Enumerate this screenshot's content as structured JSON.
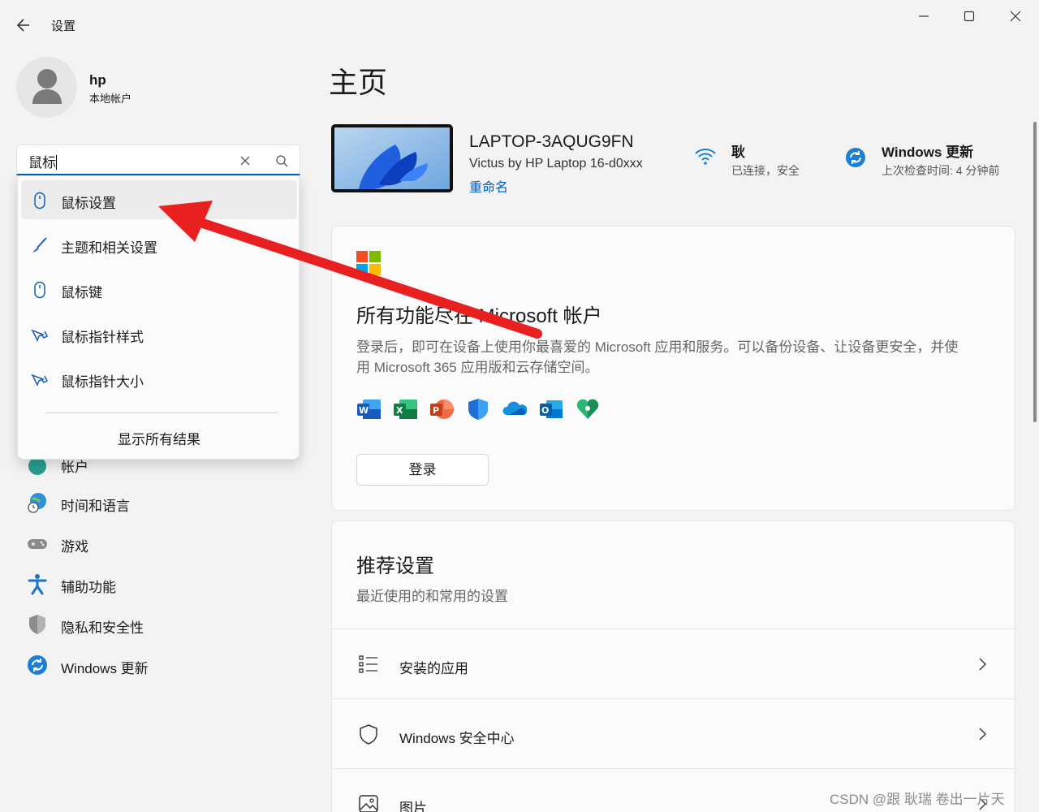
{
  "window": {
    "title": "设置"
  },
  "profile": {
    "name": "hp",
    "account_type": "本地帐户"
  },
  "search": {
    "value": "鼠标",
    "results": [
      {
        "label": "鼠标设置",
        "icon": "mouse-icon"
      },
      {
        "label": "主题和相关设置",
        "icon": "brush-icon"
      },
      {
        "label": "鼠标键",
        "icon": "mouse-icon"
      },
      {
        "label": "鼠标指针样式",
        "icon": "pointer-icon"
      },
      {
        "label": "鼠标指针大小",
        "icon": "pointer-icon"
      }
    ],
    "show_all": "显示所有结果"
  },
  "sidebar": {
    "items": [
      {
        "label": "帐户",
        "icon": "account-icon"
      },
      {
        "label": "时间和语言",
        "icon": "time-language-icon"
      },
      {
        "label": "游戏",
        "icon": "gamepad-icon"
      },
      {
        "label": "辅助功能",
        "icon": "accessibility-icon"
      },
      {
        "label": "隐私和安全性",
        "icon": "shield-icon"
      },
      {
        "label": "Windows 更新",
        "icon": "update-icon"
      }
    ]
  },
  "main": {
    "title": "主页",
    "device": {
      "name": "LAPTOP-3AQUG9FN",
      "model": "Victus by HP Laptop 16-d0xxx",
      "rename": "重命名"
    },
    "network": {
      "name": "耿",
      "status": "已连接，安全"
    },
    "update": {
      "title": "Windows 更新",
      "status": "上次检查时间: 4 分钟前"
    },
    "ms_card": {
      "heading": "所有功能尽在 Microsoft 帐户",
      "desc_line1": "登录后，即可在设备上使用你最喜爱的 Microsoft 应用和服务。可以备份设备、让设备更安全，并使",
      "desc_line2": "用 Microsoft 365 应用版和云存储空间。",
      "apps": [
        "word-icon",
        "excel-icon",
        "powerpoint-icon",
        "defender-icon",
        "onedrive-icon",
        "outlook-icon",
        "family-icon"
      ],
      "signin": "登录"
    },
    "recommended": {
      "heading": "推荐设置",
      "subtitle": "最近使用的和常用的设置",
      "items": [
        {
          "label": "安装的应用",
          "icon": "apps-list-icon"
        },
        {
          "label": "Windows 安全中心",
          "icon": "shield-outline-icon"
        },
        {
          "label": "图片",
          "icon": "picture-icon"
        }
      ]
    }
  },
  "watermark": "CSDN @跟 耿瑞 卷出一片天",
  "colors": {
    "accent": "#005fb8",
    "annotation_arrow": "#e8201f"
  }
}
